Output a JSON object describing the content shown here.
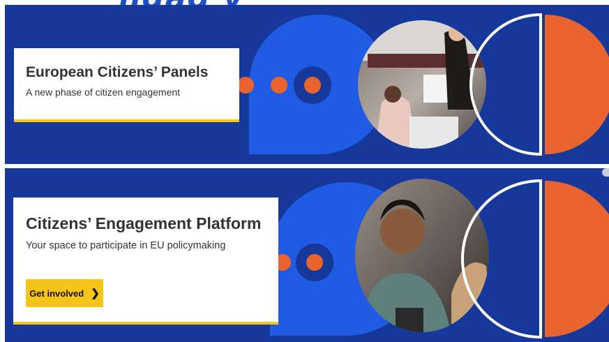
{
  "banners": [
    {
      "title": "European Citizens’ Panels",
      "subtitle": "A new phase of citizen engagement"
    },
    {
      "title": "Citizens’ Engagement Platform",
      "subtitle": "Your space to participate in EU policymaking",
      "cta_label": "Get involved",
      "cta_icon": "chevron-right-icon"
    }
  ],
  "colors": {
    "banner_bg": "#15389a",
    "shape_blue": "#1f5be3",
    "accent_orange": "#e8632e",
    "accent_yellow": "#f5c518"
  }
}
